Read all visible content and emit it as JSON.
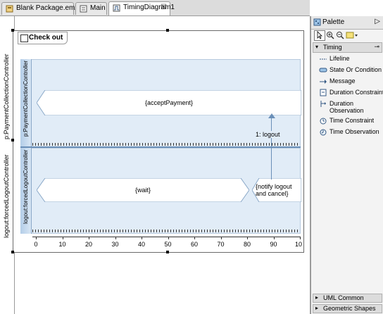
{
  "tabs": [
    {
      "label": "Blank Package.emx",
      "icon": "model-file-icon",
      "active": false
    },
    {
      "label": "Main",
      "icon": "diagram-file-icon",
      "active": false
    },
    {
      "label": "TimingDiagram1",
      "icon": "timing-diagram-icon",
      "active": true,
      "close": "☒"
    }
  ],
  "diagram": {
    "frame_title": "Check out",
    "lifelines": [
      {
        "outer_label": "p:PaymentCollectionController",
        "inner_label": "p:PaymentCollectionController",
        "states": [
          "{acceptPayment}"
        ]
      },
      {
        "outer_label": "logout:forcedLogoutController",
        "inner_label": "logout:forcedLogoutController",
        "states": [
          "{wait}",
          "{notify logout and cancel}"
        ]
      }
    ],
    "message": {
      "label": "1: logout"
    },
    "axis_ticks": [
      "0",
      "10",
      "20",
      "30",
      "40",
      "50",
      "60",
      "70",
      "80",
      "90",
      "10"
    ]
  },
  "palette": {
    "title": "Palette",
    "collapse": "▷",
    "drawer_timing": "Timing",
    "items": [
      {
        "label": "Lifeline",
        "icon": "lifeline-icon"
      },
      {
        "label": "State Or Condition",
        "icon": "state-icon"
      },
      {
        "label": "Message",
        "icon": "message-arrow-icon"
      },
      {
        "label": "Duration Constraint",
        "icon": "duration-constraint-icon"
      },
      {
        "label_line1": "Duration",
        "label_line2": "Observation",
        "icon": "duration-observation-icon"
      },
      {
        "label": "Time Constraint",
        "icon": "time-constraint-icon"
      },
      {
        "label": "Time Observation",
        "icon": "time-observation-icon"
      }
    ],
    "drawer_uml": "UML Common",
    "drawer_geo": "Geometric Shapes"
  },
  "colors": {
    "lane_fill": "#e1ecf7",
    "lane_border": "#8aa8c8",
    "accent": "#355a84"
  }
}
